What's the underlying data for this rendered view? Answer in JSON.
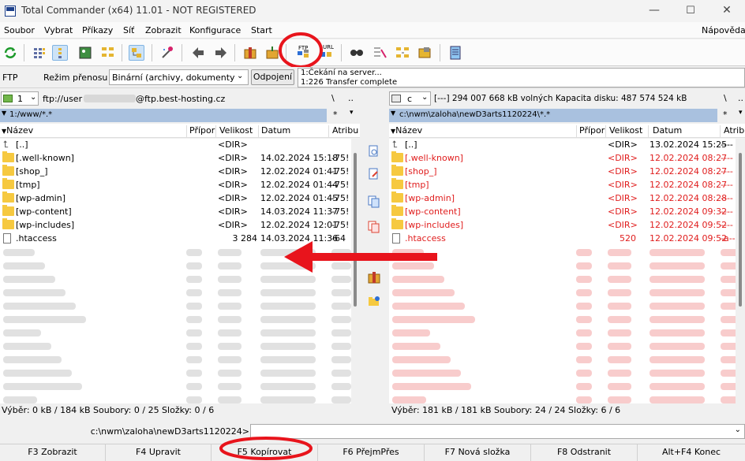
{
  "window": {
    "title": "Total Commander (x64) 11.01 - NOT REGISTERED",
    "minimize": "—",
    "maximize": "☐",
    "close": "✕"
  },
  "menu": {
    "items": [
      "Soubor",
      "Vybrat",
      "Příkazy",
      "Síť",
      "Zobrazit",
      "Konfigurace",
      "Start"
    ],
    "help": "Nápověda"
  },
  "toolbar": {
    "ftp_label": "FTP",
    "url_label": "URL"
  },
  "ftpbar": {
    "label": "FTP",
    "mode_label": "Režim přenosu",
    "mode_value": "Binární (archivy, dokumenty",
    "disconnect": "Odpojení",
    "log": [
      "1:Čekání na server...",
      "1:226 Transfer complete"
    ]
  },
  "left": {
    "drive": "1",
    "drive_path": "ftp://user",
    "drive_path_host": "@ftp.best-hosting.cz",
    "path_btn1": "\\",
    "path_btn2": "..",
    "path_header": "1:/www/*.*",
    "star": "*",
    "columns": [
      "Název",
      "Přípor",
      "Velikost",
      "Datum",
      "Atribu"
    ],
    "files": [
      {
        "name": "[..]",
        "ext": "",
        "size": "<DIR>",
        "date": "",
        "attr": "",
        "type": "up"
      },
      {
        "name": "[.well-known]",
        "ext": "",
        "size": "<DIR>",
        "date": "14.02.2024 15:18",
        "attr": "-75!",
        "type": "dir"
      },
      {
        "name": "[shop_]",
        "ext": "",
        "size": "<DIR>",
        "date": "12.02.2024 01:41",
        "attr": "-75!",
        "type": "dir"
      },
      {
        "name": "[tmp]",
        "ext": "",
        "size": "<DIR>",
        "date": "12.02.2024 01:44",
        "attr": "-75!",
        "type": "dir"
      },
      {
        "name": "[wp-admin]",
        "ext": "",
        "size": "<DIR>",
        "date": "12.02.2024 01:45",
        "attr": "-75!",
        "type": "dir"
      },
      {
        "name": "[wp-content]",
        "ext": "",
        "size": "<DIR>",
        "date": "14.03.2024 11:37",
        "attr": "-75!",
        "type": "dir"
      },
      {
        "name": "[wp-includes]",
        "ext": "",
        "size": "<DIR>",
        "date": "12.02.2024 12:01",
        "attr": "-75!",
        "type": "dir"
      },
      {
        "name": ".htaccess",
        "ext": "",
        "size": "3 284",
        "date": "14.03.2024 11:36",
        "attr": "-64",
        "type": "file"
      }
    ],
    "status": "Výběr: 0 kB / 184 kB  Soubory: 0 / 25  Složky: 0 / 6"
  },
  "right": {
    "drive": "c",
    "drive_info": "[---]  294 007 668 kB volných  Kapacita disku: 487 574 524 kB",
    "path_btn1": "\\",
    "path_btn2": "..",
    "path_header": "c:\\nwm\\zaloha\\newD3arts1120224\\*.*",
    "star": "*",
    "columns": [
      "Název",
      "Přípor",
      "Velikost",
      "Datum",
      "Atrib"
    ],
    "files": [
      {
        "name": "[..]",
        "ext": "",
        "size": "<DIR>",
        "date": "13.02.2024 15:25",
        "attr": "----",
        "type": "up"
      },
      {
        "name": "[.well-known]",
        "ext": "",
        "size": "<DIR>",
        "date": "12.02.2024 08:27",
        "attr": "----",
        "type": "dir"
      },
      {
        "name": "[shop_]",
        "ext": "",
        "size": "<DIR>",
        "date": "12.02.2024 08:27",
        "attr": "----",
        "type": "dir"
      },
      {
        "name": "[tmp]",
        "ext": "",
        "size": "<DIR>",
        "date": "12.02.2024 08:27",
        "attr": "----",
        "type": "dir"
      },
      {
        "name": "[wp-admin]",
        "ext": "",
        "size": "<DIR>",
        "date": "12.02.2024 08:28",
        "attr": "----",
        "type": "dir"
      },
      {
        "name": "[wp-content]",
        "ext": "",
        "size": "<DIR>",
        "date": "12.02.2024 09:32",
        "attr": "----",
        "type": "dir"
      },
      {
        "name": "[wp-includes]",
        "ext": "",
        "size": "<DIR>",
        "date": "12.02.2024 09:52",
        "attr": "----",
        "type": "dir"
      },
      {
        "name": ".htaccess",
        "ext": "",
        "size": "520",
        "date": "12.02.2024 09:52",
        "attr": "-a--",
        "type": "file"
      }
    ],
    "status": "Výběr: 181 kB / 181 kB  Soubory: 24 / 24  Složky: 6 / 6"
  },
  "cmdline": {
    "path": "c:\\nwm\\zaloha\\newD3arts1120224>"
  },
  "fkeys": [
    "F3 Zobrazit",
    "F4 Upravit",
    "F5 Kopírovat",
    "F6 PřejmPřes",
    "F7 Nová složka",
    "F8 Odstranit",
    "Alt+F4 Konec"
  ],
  "colors": {
    "highlight_red": "#e8141c",
    "path_header": "#a9c1df",
    "folder": "#f6c940"
  }
}
